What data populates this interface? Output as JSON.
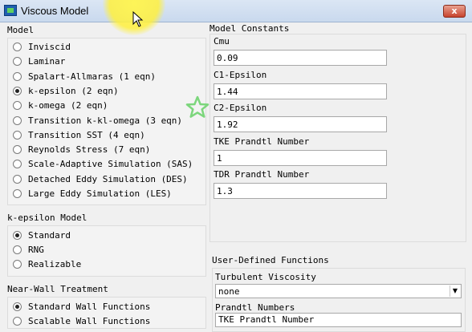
{
  "window": {
    "title": "Viscous Model",
    "close_label": "x"
  },
  "model": {
    "label": "Model",
    "options": [
      {
        "label": "Inviscid",
        "selected": false
      },
      {
        "label": "Laminar",
        "selected": false
      },
      {
        "label": "Spalart-Allmaras (1 eqn)",
        "selected": false
      },
      {
        "label": "k-epsilon (2 eqn)",
        "selected": true
      },
      {
        "label": "k-omega (2 eqn)",
        "selected": false
      },
      {
        "label": "Transition k-kl-omega (3 eqn)",
        "selected": false
      },
      {
        "label": "Transition SST (4 eqn)",
        "selected": false
      },
      {
        "label": "Reynolds Stress (7 eqn)",
        "selected": false
      },
      {
        "label": "Scale-Adaptive Simulation (SAS)",
        "selected": false
      },
      {
        "label": "Detached Eddy Simulation (DES)",
        "selected": false
      },
      {
        "label": "Large Eddy Simulation (LES)",
        "selected": false
      }
    ]
  },
  "k_epsilon_model": {
    "label": "k-epsilon Model",
    "options": [
      {
        "label": "Standard",
        "selected": true
      },
      {
        "label": "RNG",
        "selected": false
      },
      {
        "label": "Realizable",
        "selected": false
      }
    ]
  },
  "near_wall": {
    "label": "Near-Wall Treatment",
    "options": [
      {
        "label": "Standard Wall Functions",
        "selected": true
      },
      {
        "label": "Scalable Wall Functions",
        "selected": false
      }
    ]
  },
  "model_constants": {
    "label": "Model Constants",
    "fields": [
      {
        "label": "Cmu",
        "value": "0.09"
      },
      {
        "label": "C1-Epsilon",
        "value": "1.44"
      },
      {
        "label": "C2-Epsilon",
        "value": "1.92"
      },
      {
        "label": "TKE Prandtl Number",
        "value": "1"
      },
      {
        "label": "TDR Prandtl Number",
        "value": "1.3"
      }
    ]
  },
  "udf": {
    "label": "User-Defined Functions",
    "turbulent_viscosity_label": "Turbulent Viscosity",
    "turbulent_viscosity_value": "none",
    "prandtl_numbers_label": "Prandtl Numbers",
    "tke_prandtl_label": "TKE Prandtl Number"
  },
  "colors": {
    "accent": "#1f5fb0",
    "close": "#c7432d",
    "highlight": "#fff03c",
    "star": "#7cd67c"
  },
  "icons": [
    "app-icon",
    "close-icon",
    "cursor-arrow-icon",
    "star-icon",
    "chevron-down-icon"
  ]
}
